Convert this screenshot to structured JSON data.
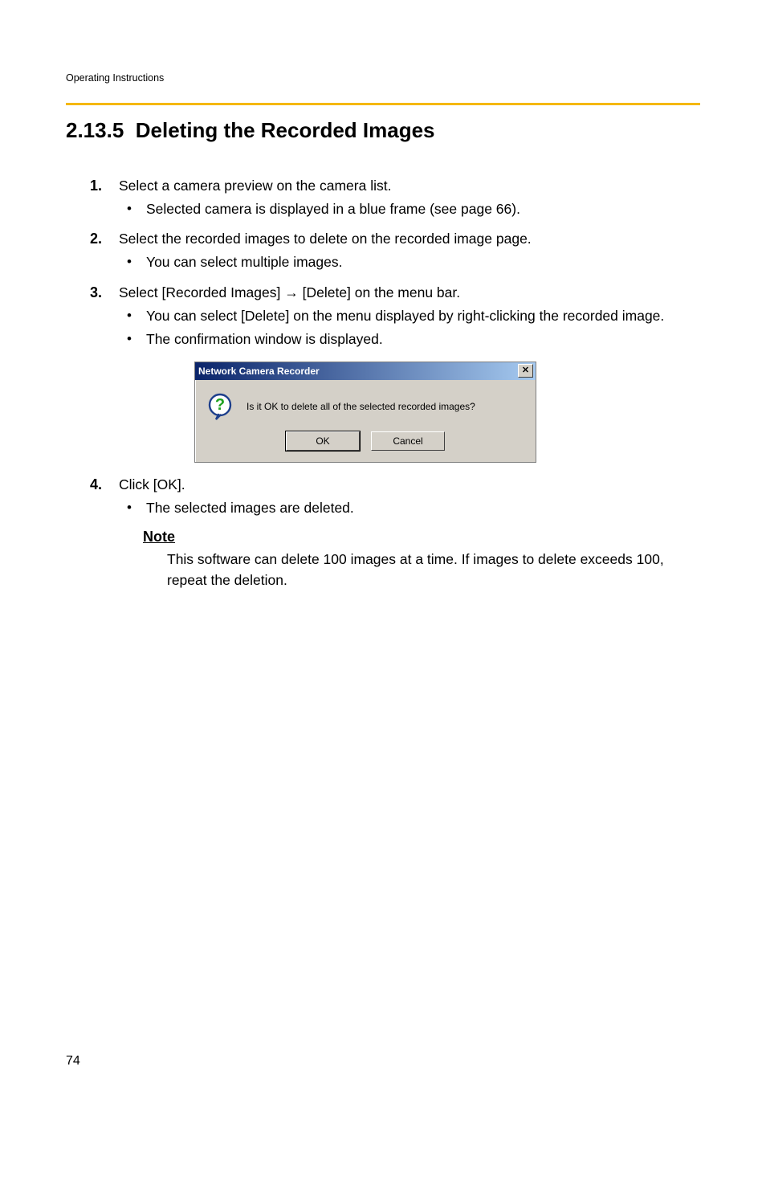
{
  "header": {
    "running": "Operating Instructions"
  },
  "section": {
    "number": "2.13.5",
    "title": "Deleting the Recorded Images"
  },
  "steps": [
    {
      "num": "1.",
      "text": "Select a camera preview on the camera list.",
      "bullets": [
        "Selected camera is displayed in a blue frame (see page 66)."
      ]
    },
    {
      "num": "2.",
      "text": "Select the recorded images to delete on the recorded image page.",
      "bullets": [
        "You can select multiple images."
      ]
    },
    {
      "num": "3.",
      "text_pre": "Select [Recorded Images]",
      "text_post": "[Delete] on the menu bar.",
      "bullets": [
        "You can select [Delete] on the menu displayed by right-clicking the recorded image.",
        "The confirmation window is displayed."
      ]
    },
    {
      "num": "4.",
      "text": "Click [OK].",
      "bullets": [
        "The selected images are deleted."
      ]
    }
  ],
  "dialog": {
    "title": "Network Camera Recorder",
    "message": "Is it OK to delete all of the selected recorded images?",
    "ok": "OK",
    "cancel": "Cancel",
    "close_glyph": "✕"
  },
  "note": {
    "heading": "Note",
    "body": "This software can delete 100 images at a time. If images to delete exceeds 100, repeat the deletion."
  },
  "page_number": "74"
}
